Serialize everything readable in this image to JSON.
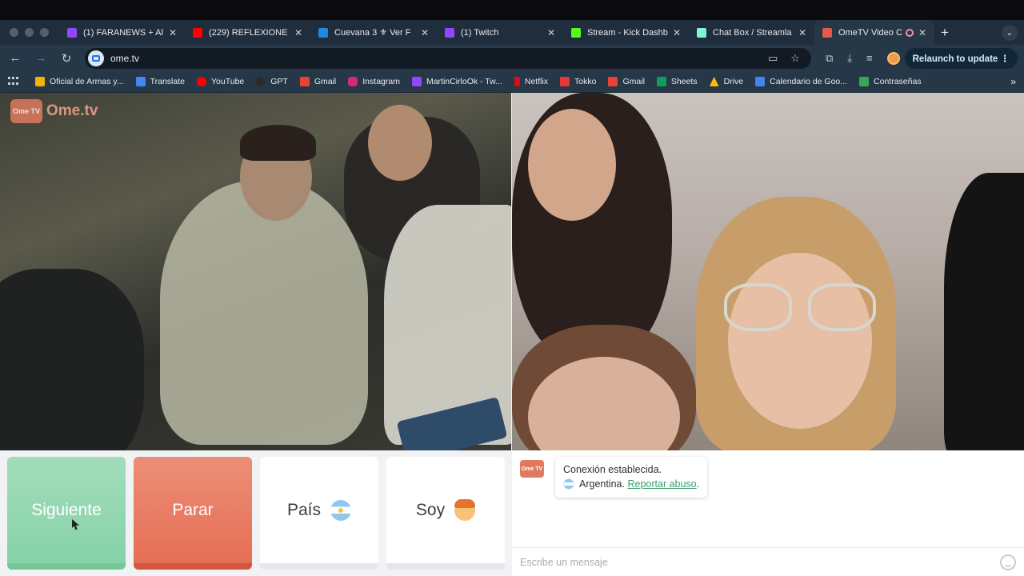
{
  "browser": {
    "tabs": [
      {
        "title": "(1) FARANEWS + Al",
        "favicon_color": "#9146ff",
        "active": false
      },
      {
        "title": "(229) REFLEXIONE",
        "favicon_color": "#ff0000",
        "active": false
      },
      {
        "title": "Cuevana 3 ⚜ Ver F",
        "favicon_color": "#1e88e5",
        "active": false
      },
      {
        "title": "(1) Twitch",
        "favicon_color": "#9146ff",
        "active": false
      },
      {
        "title": "Stream - Kick Dashb",
        "favicon_color": "#53fc18",
        "active": false
      },
      {
        "title": "Chat Box / Streamla",
        "favicon_color": "#80f5d2",
        "active": false
      },
      {
        "title": "OmeTV Video C",
        "favicon_color": "#e55a4e",
        "active": true
      }
    ],
    "url": "ome.tv",
    "relaunch_label": "Relaunch to update",
    "bookmarks": [
      {
        "label": "Oficial de Armas y...",
        "color": "#f4b400"
      },
      {
        "label": "Translate",
        "color": "#4285f4"
      },
      {
        "label": "YouTube",
        "color": "#ff0000"
      },
      {
        "label": "GPT",
        "color": "#2b2b2b"
      },
      {
        "label": "Gmail",
        "color": "#ea4335"
      },
      {
        "label": "Instagram",
        "color": "#d62976"
      },
      {
        "label": "MartinCirloOk - Tw...",
        "color": "#9146ff"
      },
      {
        "label": "Netflix",
        "color": "#e50914"
      },
      {
        "label": "Tokko",
        "color": "#e53935"
      },
      {
        "label": "Gmail",
        "color": "#ea4335"
      },
      {
        "label": "Sheets",
        "color": "#0f9d58"
      },
      {
        "label": "Drive",
        "color": "#fbbc04"
      },
      {
        "label": "Calendario de Goo...",
        "color": "#4285f4"
      },
      {
        "label": "Contraseñas",
        "color": "#34a853"
      }
    ]
  },
  "ometv": {
    "logo_badge": "Ome TV",
    "logo_text": "Ome.tv",
    "buttons": {
      "next": "Siguiente",
      "stop": "Parar",
      "country": "País",
      "me": "Soy"
    },
    "chat": {
      "status": "Conexión establecida.",
      "country": "Argentina.",
      "report_link": "Reportar abuso",
      "report_suffix": ".",
      "input_placeholder": "Escribe un mensaje"
    }
  }
}
